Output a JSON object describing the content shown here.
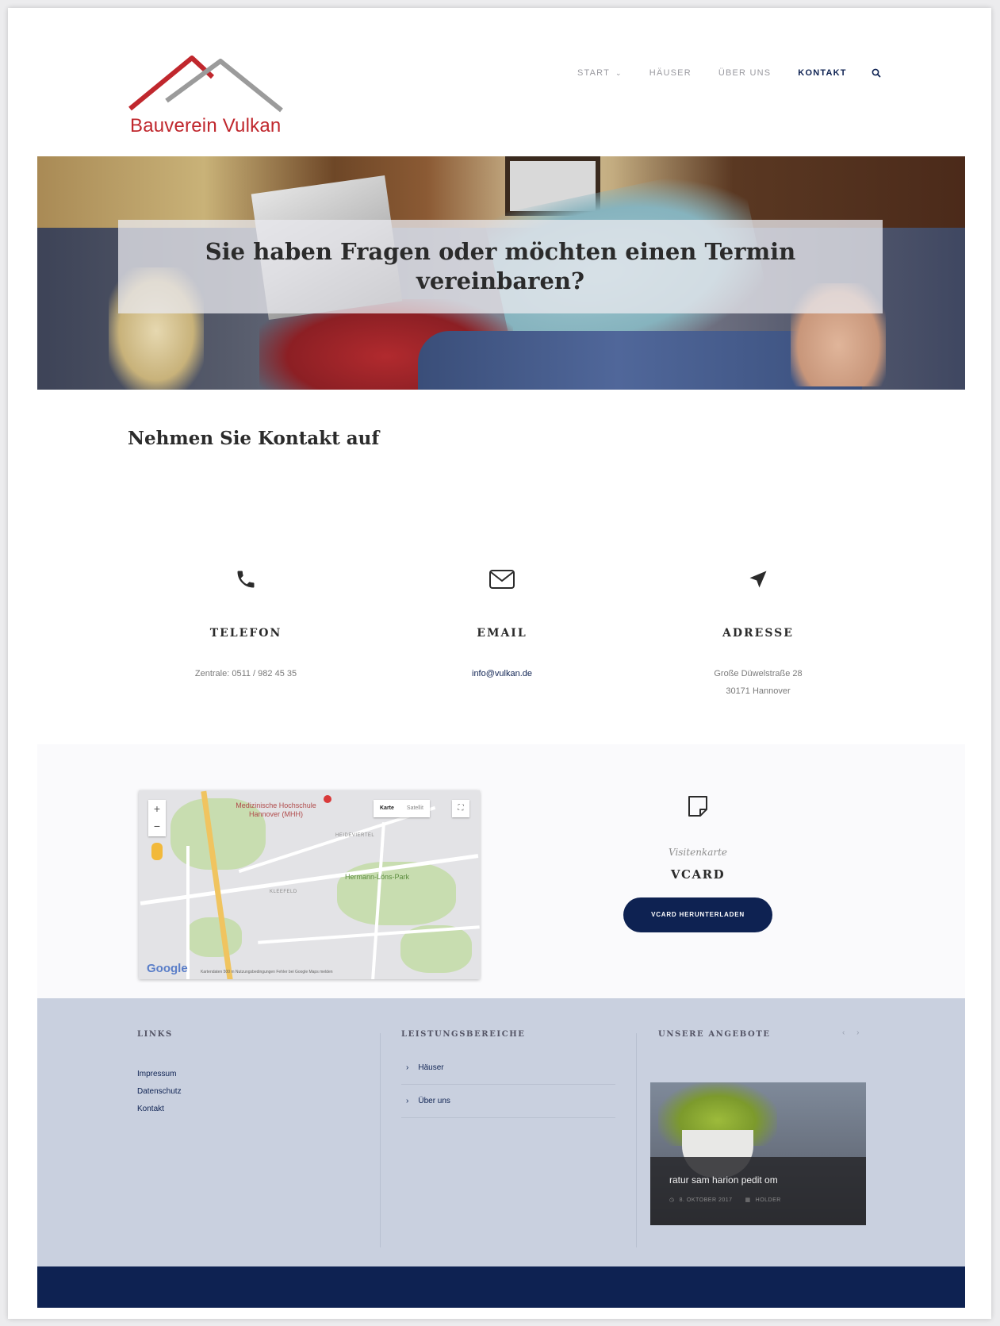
{
  "brand": {
    "name": "Bauverein Vulkan",
    "color_red": "#c0272d",
    "color_gray": "#9b9b9b"
  },
  "nav": {
    "items": [
      {
        "label": "START",
        "has_dropdown": true
      },
      {
        "label": "HÄUSER"
      },
      {
        "label": "ÜBER UNS"
      },
      {
        "label": "KONTAKT",
        "active": true
      }
    ],
    "accent": "#0e2252"
  },
  "hero": {
    "title": "Sie haben Fragen oder möchten einen Termin vereinbaren?"
  },
  "contact": {
    "title": "Nehmen Sie Kontakt auf",
    "phone": {
      "heading": "TELEFON",
      "value": "Zentrale: 0511 / 982 45 35",
      "icon": "phone-icon"
    },
    "email": {
      "heading": "EMAIL",
      "value": "info@vulkan.de",
      "icon": "envelope-icon"
    },
    "address": {
      "heading": "ADRESSE",
      "line1": "Große Düwelstraße 28",
      "line2": "30171 Hannover",
      "icon": "location-arrow-icon"
    }
  },
  "map": {
    "label_poi": "Medizinische Hochschule Hannover (MHH)",
    "label_district1": "HEIDEVIERTEL",
    "label_district2": "KLEEFELD",
    "label_park": "Hermann-Löns-Park",
    "type_map": "Karte",
    "type_sat": "Satellit",
    "zoom_in": "+",
    "zoom_out": "−",
    "google": "Google",
    "footer": "Kartendaten   500 m   Nutzungsbedingungen   Fehler bei Google Maps melden"
  },
  "vcard": {
    "subtitle": "Visitenkarte",
    "title": "VCARD",
    "button": "VCARD HERUNTERLADEN",
    "icon": "note-icon"
  },
  "footer": {
    "links_title": "LINKS",
    "links": [
      "Impressum",
      "Datenschutz",
      "Kontakt"
    ],
    "services_title": "LEISTUNGSBEREICHE",
    "services": [
      "Häuser",
      "Über uns"
    ],
    "offers_title": "UNSERE ANGEBOTE",
    "pager": "‹ ›",
    "offer": {
      "title": "ratur sam harion pedit om",
      "date": "8. OKTOBER 2017",
      "category": "HOLDER"
    }
  }
}
